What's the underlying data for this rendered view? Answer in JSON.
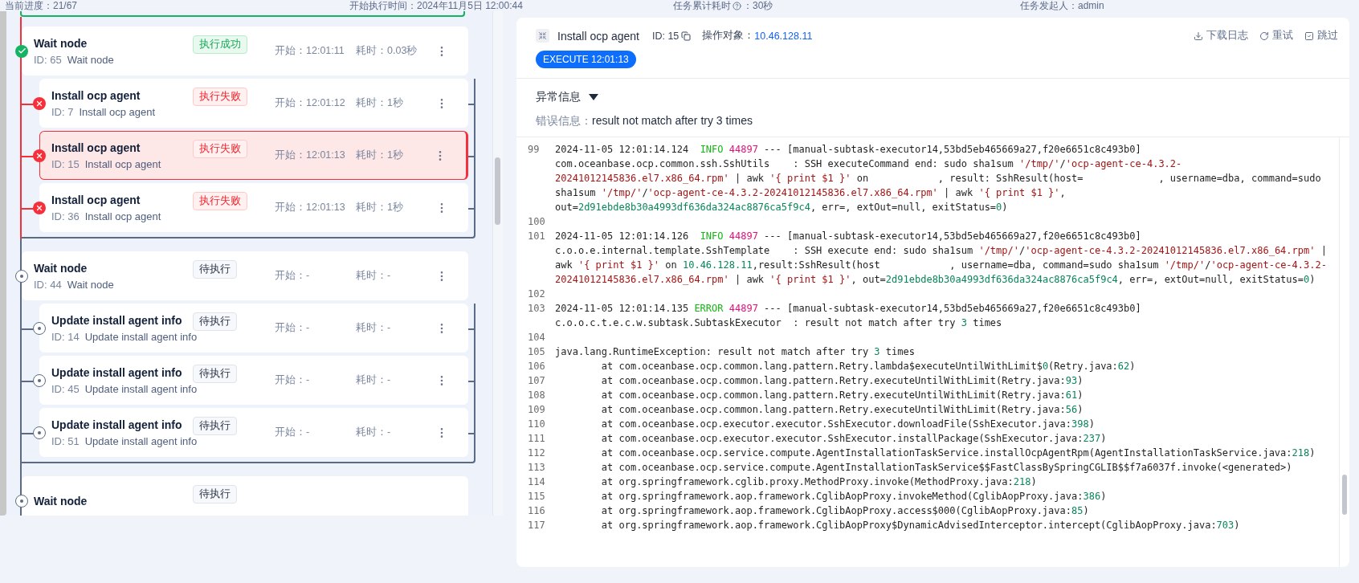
{
  "summary": {
    "progress": "当前进度：21/67",
    "start_time": "开始执行时间：2024年11月5日 12:00:44",
    "elapsed_label": "任务累计耗时",
    "elapsed_value": "：30秒",
    "initiator": "任务发起人：admin"
  },
  "tree": [
    {
      "title": "Wait node",
      "id": "ID: 65",
      "subtitle": "Wait node",
      "kind": "success",
      "status_label": "执行成功",
      "start": "开始：12:01:11",
      "duration": "耗时：0.03秒",
      "selected": false,
      "children": [
        {
          "title": "Install ocp agent",
          "id": "ID: 7",
          "subtitle": "Install ocp agent",
          "kind": "failed",
          "status_label": "执行失败",
          "start": "开始：12:01:12",
          "duration": "耗时：1秒",
          "selected": false
        },
        {
          "title": "Install ocp agent",
          "id": "ID: 15",
          "subtitle": "Install ocp agent",
          "kind": "failed",
          "status_label": "执行失败",
          "start": "开始：12:01:13",
          "duration": "耗时：1秒",
          "selected": true
        },
        {
          "title": "Install ocp agent",
          "id": "ID: 36",
          "subtitle": "Install ocp agent",
          "kind": "failed",
          "status_label": "执行失败",
          "start": "开始：12:01:13",
          "duration": "耗时：1秒",
          "selected": false
        }
      ]
    },
    {
      "title": "Wait node",
      "id": "ID: 44",
      "subtitle": "Wait node",
      "kind": "pending",
      "status_label": "待执行",
      "start": "开始：-",
      "duration": "耗时：-",
      "selected": false,
      "children": [
        {
          "title": "Update install agent info",
          "id": "ID: 14",
          "subtitle": "Update install agent info",
          "kind": "pending",
          "status_label": "待执行",
          "start": "开始：-",
          "duration": "耗时：-",
          "selected": false
        },
        {
          "title": "Update install agent info",
          "id": "ID: 45",
          "subtitle": "Update install agent info",
          "kind": "pending",
          "status_label": "待执行",
          "start": "开始：-",
          "duration": "耗时：-",
          "selected": false
        },
        {
          "title": "Update install agent info",
          "id": "ID: 51",
          "subtitle": "Update install agent info",
          "kind": "pending",
          "status_label": "待执行",
          "start": "开始：-",
          "duration": "耗时：-",
          "selected": false
        }
      ]
    },
    {
      "title": "Wait node",
      "kind": "pending",
      "status_label": "待执行",
      "selected": false
    }
  ],
  "detail": {
    "title": "Install ocp agent",
    "id": "ID: 15",
    "target_label": "操作对象：",
    "target": "10.46.128.11",
    "actions": [
      {
        "kind": "download",
        "label": "下载日志"
      },
      {
        "kind": "retry",
        "label": "重试"
      },
      {
        "kind": "skip",
        "label": "跳过"
      }
    ],
    "stage": "EXECUTE 12:01:13",
    "exception": {
      "title": "异常信息",
      "expanded": true,
      "error_label": "错误信息：",
      "error": "result not match after try 3 times"
    },
    "log": [
      {
        "number": "99",
        "segments": [
          {
            "kind": "text",
            "text": "2024-11-05 12:01:14.124  "
          },
          {
            "kind": "level",
            "text": "INFO"
          },
          {
            "kind": "pid",
            "text": " 44897"
          },
          {
            "kind": "text",
            "text": " --- [manual-subtask-executor14,53bd5eb465669a27,f20e6651c8c493b0] com.oceanbase.ocp.common.ssh.SshUtils    : SSH executeCommand end: sudo sha1sum "
          },
          {
            "kind": "str",
            "text": "'/tmp/'"
          },
          {
            "kind": "text",
            "text": "/"
          },
          {
            "kind": "str",
            "text": "'ocp-agent-ce-4.3.2-20241012145836.el7.x86_64.rpm'"
          },
          {
            "kind": "text",
            "text": " | awk "
          },
          {
            "kind": "str",
            "text": "'{ print $1 }'"
          },
          {
            "kind": "text",
            "text": " on            , result: SshResult(host=             , username=dba, command=sudo sha1sum "
          },
          {
            "kind": "str",
            "text": "'/tmp/'"
          },
          {
            "kind": "text",
            "text": "/"
          },
          {
            "kind": "str",
            "text": "'ocp-agent-ce-4.3.2-20241012145836.el7.x86_64.rpm'"
          },
          {
            "kind": "text",
            "text": " | awk "
          },
          {
            "kind": "str",
            "text": "'{ print $1 }'"
          },
          {
            "kind": "text",
            "text": ", out="
          },
          {
            "kind": "num",
            "text": "2d91ebde8b30a4993df636da324ac8876ca5f9c4"
          },
          {
            "kind": "text",
            "text": ", err=, extOut=null, exitStatus="
          },
          {
            "kind": "num",
            "text": "0"
          },
          {
            "kind": "text",
            "text": ")"
          }
        ]
      },
      {
        "number": "100"
      },
      {
        "number": "101",
        "segments": [
          {
            "kind": "text",
            "text": "2024-11-05 12:01:14.126  "
          },
          {
            "kind": "level",
            "text": "INFO"
          },
          {
            "kind": "pid",
            "text": " 44897"
          },
          {
            "kind": "text",
            "text": " --- [manual-subtask-executor14,53bd5eb465669a27,f20e6651c8c493b0] c.o.o.e.internal.template.SshTemplate    : SSH execute end: sudo sha1sum "
          },
          {
            "kind": "str",
            "text": "'/tmp/'"
          },
          {
            "kind": "text",
            "text": "/"
          },
          {
            "kind": "str",
            "text": "'ocp-agent-ce-4.3.2-20241012145836.el7.x86_64.rpm'"
          },
          {
            "kind": "text",
            "text": " | awk "
          },
          {
            "kind": "str",
            "text": "'{ print $1 }'"
          },
          {
            "kind": "text",
            "text": " on "
          },
          {
            "kind": "num",
            "text": "10.46.128.11"
          },
          {
            "kind": "text",
            "text": ",result:SshResult(host            , username=dba, command=sudo sha1sum "
          },
          {
            "kind": "str",
            "text": "'/tmp/'"
          },
          {
            "kind": "text",
            "text": "/"
          },
          {
            "kind": "str",
            "text": "'ocp-agent-ce-4.3.2-20241012145836.el7.x86_64.rpm'"
          },
          {
            "kind": "text",
            "text": " | awk "
          },
          {
            "kind": "str",
            "text": "'{ print $1 }'"
          },
          {
            "kind": "text",
            "text": ", out="
          },
          {
            "kind": "num",
            "text": "2d91ebde8b30a4993df636da324ac8876ca5f9c4"
          },
          {
            "kind": "text",
            "text": ", err=, extOut=null, exitStatus="
          },
          {
            "kind": "num",
            "text": "0"
          },
          {
            "kind": "text",
            "text": ")"
          }
        ]
      },
      {
        "number": "102"
      },
      {
        "number": "103",
        "segments": [
          {
            "kind": "text",
            "text": "2024-11-05 12:01:14.135 "
          },
          {
            "kind": "level",
            "text": "ERROR"
          },
          {
            "kind": "pid",
            "text": " 44897"
          },
          {
            "kind": "text",
            "text": " --- [manual-subtask-executor14,53bd5eb465669a27,f20e6651c8c493b0] c.o.o.c.t.e.c.w.subtask.SubtaskExecutor  : result not match after try "
          },
          {
            "kind": "num",
            "text": "3"
          },
          {
            "kind": "text",
            "text": " times"
          }
        ]
      },
      {
        "number": "104"
      },
      {
        "number": "105",
        "segments": [
          {
            "kind": "text",
            "text": "java.lang.RuntimeException: result not match after try "
          },
          {
            "kind": "num",
            "text": "3"
          },
          {
            "kind": "text",
            "text": " times"
          }
        ]
      },
      {
        "number": "106",
        "segments": [
          {
            "kind": "text",
            "text": "        at com.oceanbase.ocp.common.lang.pattern.Retry.lambda$executeUntilWithLimit$"
          },
          {
            "kind": "num",
            "text": "0"
          },
          {
            "kind": "text",
            "text": "(Retry.java:"
          },
          {
            "kind": "num",
            "text": "62"
          },
          {
            "kind": "text",
            "text": ")"
          }
        ]
      },
      {
        "number": "107",
        "segments": [
          {
            "kind": "text",
            "text": "        at com.oceanbase.ocp.common.lang.pattern.Retry.executeUntilWithLimit(Retry.java:"
          },
          {
            "kind": "num",
            "text": "93"
          },
          {
            "kind": "text",
            "text": ")"
          }
        ]
      },
      {
        "number": "108",
        "segments": [
          {
            "kind": "text",
            "text": "        at com.oceanbase.ocp.common.lang.pattern.Retry.executeUntilWithLimit(Retry.java:"
          },
          {
            "kind": "num",
            "text": "61"
          },
          {
            "kind": "text",
            "text": ")"
          }
        ]
      },
      {
        "number": "109",
        "segments": [
          {
            "kind": "text",
            "text": "        at com.oceanbase.ocp.common.lang.pattern.Retry.executeUntilWithLimit(Retry.java:"
          },
          {
            "kind": "num",
            "text": "56"
          },
          {
            "kind": "text",
            "text": ")"
          }
        ]
      },
      {
        "number": "110",
        "segments": [
          {
            "kind": "text",
            "text": "        at com.oceanbase.ocp.executor.executor.SshExecutor.downloadFile(SshExecutor.java:"
          },
          {
            "kind": "num",
            "text": "398"
          },
          {
            "kind": "text",
            "text": ")"
          }
        ]
      },
      {
        "number": "111",
        "segments": [
          {
            "kind": "text",
            "text": "        at com.oceanbase.ocp.executor.executor.SshExecutor.installPackage(SshExecutor.java:"
          },
          {
            "kind": "num",
            "text": "237"
          },
          {
            "kind": "text",
            "text": ")"
          }
        ]
      },
      {
        "number": "112",
        "segments": [
          {
            "kind": "text",
            "text": "        at com.oceanbase.ocp.service.compute.AgentInstallationTaskService.installOcpAgentRpm(AgentInstallationTaskService.java:"
          },
          {
            "kind": "num",
            "text": "218"
          },
          {
            "kind": "text",
            "text": ")"
          }
        ]
      },
      {
        "number": "113",
        "segments": [
          {
            "kind": "text",
            "text": "        at com.oceanbase.ocp.service.compute.AgentInstallationTaskService$$FastClassBySpringCGLIB$$f7a6037f.invoke(<generated>)"
          }
        ]
      },
      {
        "number": "114",
        "segments": [
          {
            "kind": "text",
            "text": "        at org.springframework.cglib.proxy.MethodProxy.invoke(MethodProxy.java:"
          },
          {
            "kind": "num",
            "text": "218"
          },
          {
            "kind": "text",
            "text": ")"
          }
        ]
      },
      {
        "number": "115",
        "segments": [
          {
            "kind": "text",
            "text": "        at org.springframework.aop.framework.CglibAopProxy.invokeMethod(CglibAopProxy.java:"
          },
          {
            "kind": "num",
            "text": "386"
          },
          {
            "kind": "text",
            "text": ")"
          }
        ]
      },
      {
        "number": "116",
        "segments": [
          {
            "kind": "text",
            "text": "        at org.springframework.aop.framework.CglibAopProxy.access$000(CglibAopProxy.java:"
          },
          {
            "kind": "num",
            "text": "85"
          },
          {
            "kind": "text",
            "text": ")"
          }
        ]
      },
      {
        "number": "117",
        "segments": [
          {
            "kind": "text",
            "text": "        at org.springframework.aop.framework.CglibAopProxy$DynamicAdvisedInterceptor.intercept(CglibAopProxy.java:"
          },
          {
            "kind": "num",
            "text": "703"
          },
          {
            "kind": "text",
            "text": ")"
          }
        ]
      }
    ]
  }
}
